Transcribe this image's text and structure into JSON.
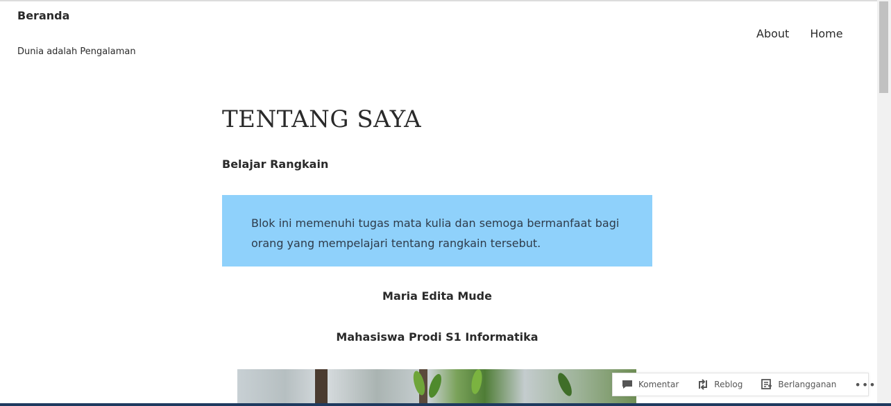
{
  "header": {
    "site_title": "Beranda",
    "tagline": "Dunia adalah Pengalaman"
  },
  "nav": {
    "items": [
      {
        "label": "About"
      },
      {
        "label": "Home"
      }
    ]
  },
  "content": {
    "page_title": "TENTANG SAYA",
    "subtitle": "Belajar Rangkain",
    "callout_text": "Blok ini memenuhi tugas mata kulia dan semoga bermanfaat bagi orang yang mempelajari tentang rangkain tersebut.",
    "name": "Maria Edita Mude",
    "role": "Mahasiswa Prodi S1 Informatika"
  },
  "action_bar": {
    "comment_label": "Komentar",
    "reblog_label": "Reblog",
    "subscribe_label": "Berlangganan",
    "more_label": "•••"
  },
  "icons": {
    "comment": "comment-icon",
    "reblog": "reblog-icon",
    "subscribe": "subscribe-icon",
    "more": "more-icon"
  },
  "colors": {
    "callout_bg": "#8fd1fb",
    "text": "#2a2a2a"
  }
}
